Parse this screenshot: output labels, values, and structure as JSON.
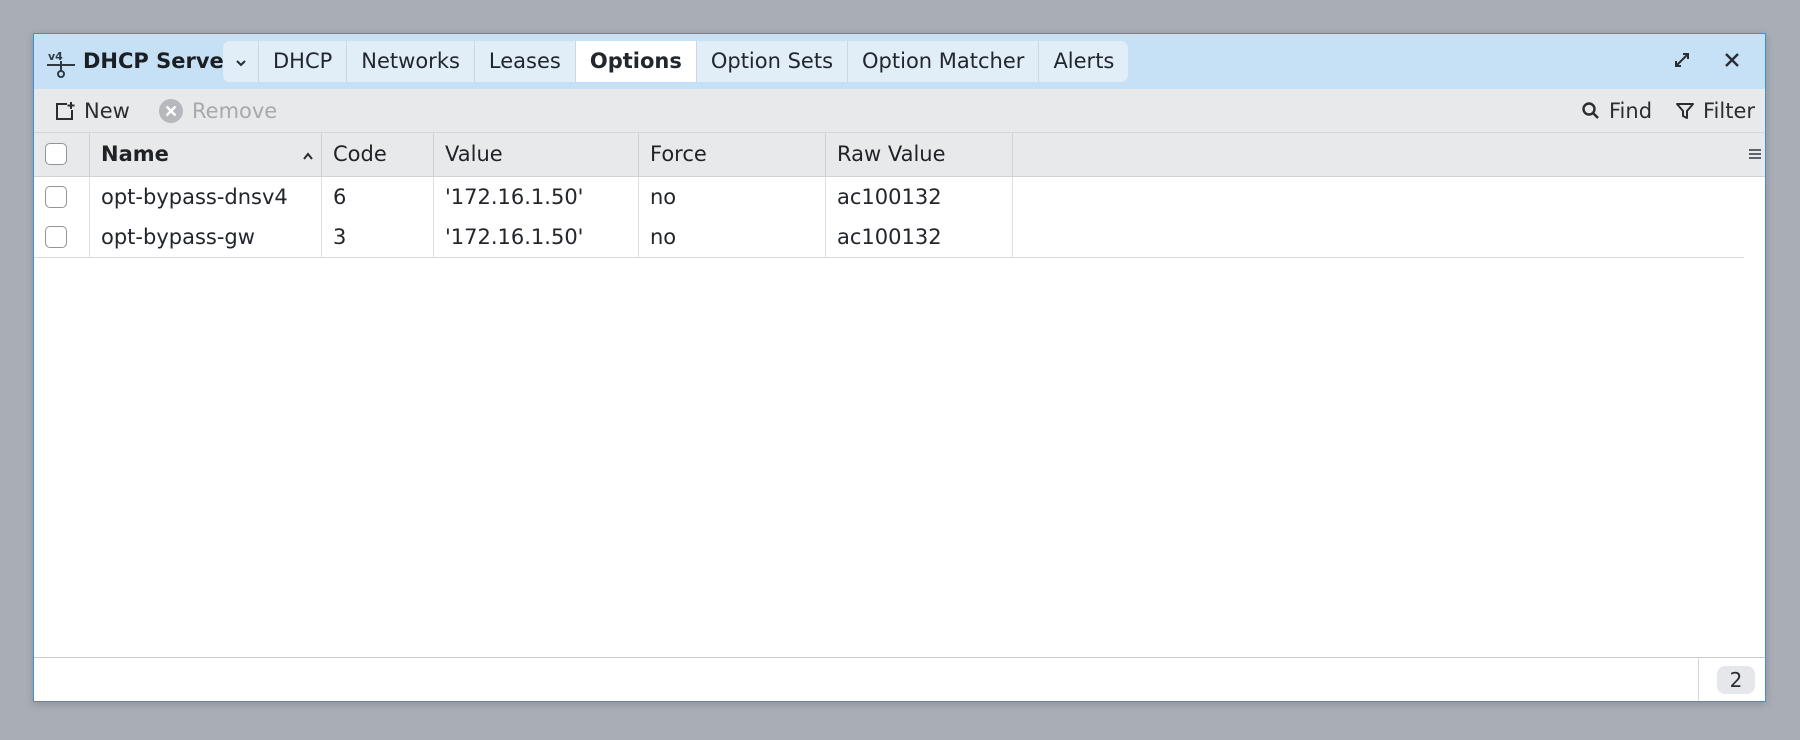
{
  "window": {
    "app_title": "DHCP Server",
    "app_icon": "ipv4-network-icon",
    "tabs": [
      {
        "label": "DHCP",
        "active": false
      },
      {
        "label": "Networks",
        "active": false
      },
      {
        "label": "Leases",
        "active": false
      },
      {
        "label": "Options",
        "active": true
      },
      {
        "label": "Option Sets",
        "active": false
      },
      {
        "label": "Option Matcher",
        "active": false
      },
      {
        "label": "Alerts",
        "active": false
      }
    ]
  },
  "toolbar": {
    "new_label": "New",
    "remove_label": "Remove",
    "find_label": "Find",
    "filter_label": "Filter"
  },
  "table": {
    "columns": [
      "Name",
      "Code",
      "Value",
      "Force",
      "Raw Value"
    ],
    "sort": {
      "column": "Name",
      "direction": "ascending"
    },
    "rows": [
      {
        "name": "opt-bypass-dnsv4",
        "code": "6",
        "value": "'172.16.1.50'",
        "force": "no",
        "raw_value": "ac100132"
      },
      {
        "name": "opt-bypass-gw",
        "code": "3",
        "value": "'172.16.1.50'",
        "force": "no",
        "raw_value": "ac100132"
      }
    ]
  },
  "footer": {
    "count": "2"
  },
  "colors": {
    "titlebar": "#c6e1f5",
    "window_border": "#3f8fd8",
    "toolbar": "#e8e9ea",
    "background": "#a9aeb6"
  }
}
